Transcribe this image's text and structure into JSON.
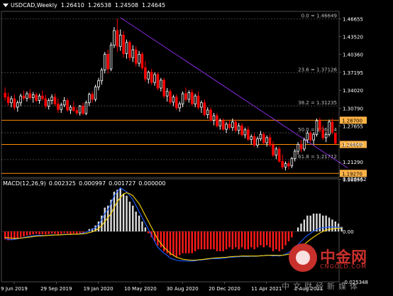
{
  "header": {
    "symbol": "USDCAD,Weekly",
    "open": "1.26410",
    "high": "1.26538",
    "low": "1.24508",
    "close": "1.24645"
  },
  "macd_header": {
    "label": "MACD(12,26,9)",
    "v1": "0.002325",
    "v2": "0.000997",
    "v3": "0.001727",
    "v4": "0.000000"
  },
  "watermark": {
    "brand": "中金网",
    "site": "CNGOLD.COM",
    "tagline": "中文财经新媒体"
  },
  "colors": {
    "background": "#000000",
    "bull_candle": "#ffffff",
    "bear_candle": "#ff0000",
    "trendline": "#8a2be2",
    "horizontal_level": "#ff8c00",
    "fib_level": "#505050",
    "macd_signal": "#ffd700",
    "macd_line": "#1e5cff",
    "price_tag": "#ffb347"
  },
  "chart_data": [
    {
      "type": "candlestick",
      "title": "USDCAD,Weekly",
      "ylim": [
        1.1855,
        1.48
      ],
      "y_ticks": [
        "1.46655",
        "1.43520",
        "1.40360",
        "1.37195",
        "1.34020",
        "1.30790",
        "1.27655",
        "1.24440",
        "1.21290",
        "1.18255"
      ],
      "x_ticks": [
        "9 Jun 2019",
        "29 Sep 2019",
        "19 Jan 2020",
        "10 May 2020",
        "30 Aug 2020",
        "20 Dec 2020",
        "11 Apr 2021",
        "1 Aug 2021"
      ],
      "fib_levels": [
        {
          "label": "0.0 = 1.46649",
          "value": 1.46649
        },
        {
          "label": "23.6 = 1.37126",
          "value": 1.37126
        },
        {
          "label": "38.2 = 1.31235",
          "value": 1.31235
        },
        {
          "label": "50.0 = 1.26474",
          "value": 1.26474
        },
        {
          "label": "61.8 = 1.21712",
          "value": 1.21712
        }
      ],
      "horizontal_levels": [
        {
          "label": "1.28700",
          "value": 1.287
        },
        {
          "label": "1.24400",
          "value": 1.244
        },
        {
          "label": "1.19270",
          "value": 1.1927
        }
      ],
      "trendline": {
        "from": {
          "week": 37,
          "price": 1.469
        },
        "to": {
          "week": 110,
          "price": 1.202
        }
      },
      "candles": [
        [
          1.335,
          1.345,
          1.322,
          1.328
        ],
        [
          1.328,
          1.336,
          1.312,
          1.318
        ],
        [
          1.318,
          1.33,
          1.31,
          1.325
        ],
        [
          1.325,
          1.333,
          1.305,
          1.31
        ],
        [
          1.31,
          1.322,
          1.302,
          1.318
        ],
        [
          1.318,
          1.334,
          1.312,
          1.33
        ],
        [
          1.33,
          1.34,
          1.322,
          1.326
        ],
        [
          1.326,
          1.338,
          1.32,
          1.334
        ],
        [
          1.334,
          1.342,
          1.323,
          1.327
        ],
        [
          1.327,
          1.337,
          1.318,
          1.332
        ],
        [
          1.332,
          1.336,
          1.319,
          1.322
        ],
        [
          1.322,
          1.334,
          1.316,
          1.33
        ],
        [
          1.33,
          1.34,
          1.322,
          1.325
        ],
        [
          1.325,
          1.332,
          1.308,
          1.312
        ],
        [
          1.312,
          1.326,
          1.306,
          1.322
        ],
        [
          1.322,
          1.333,
          1.315,
          1.328
        ],
        [
          1.328,
          1.334,
          1.312,
          1.316
        ],
        [
          1.316,
          1.325,
          1.3,
          1.306
        ],
        [
          1.306,
          1.318,
          1.3,
          1.314
        ],
        [
          1.314,
          1.328,
          1.31,
          1.322
        ],
        [
          1.322,
          1.326,
          1.302,
          1.305
        ],
        [
          1.305,
          1.314,
          1.298,
          1.31
        ],
        [
          1.31,
          1.32,
          1.302,
          1.304
        ],
        [
          1.304,
          1.31,
          1.296,
          1.3
        ],
        [
          1.3,
          1.314,
          1.295,
          1.312
        ],
        [
          1.312,
          1.318,
          1.296,
          1.299
        ],
        [
          1.299,
          1.322,
          1.296,
          1.318
        ],
        [
          1.318,
          1.336,
          1.312,
          1.333
        ],
        [
          1.333,
          1.338,
          1.318,
          1.324
        ],
        [
          1.324,
          1.35,
          1.32,
          1.346
        ],
        [
          1.346,
          1.362,
          1.34,
          1.357
        ],
        [
          1.357,
          1.38,
          1.35,
          1.376
        ],
        [
          1.376,
          1.408,
          1.37,
          1.404
        ],
        [
          1.404,
          1.412,
          1.37,
          1.378
        ],
        [
          1.378,
          1.425,
          1.374,
          1.42
        ],
        [
          1.42,
          1.452,
          1.415,
          1.446
        ],
        [
          1.446,
          1.467,
          1.408,
          1.418
        ],
        [
          1.418,
          1.448,
          1.41,
          1.438
        ],
        [
          1.438,
          1.445,
          1.398,
          1.405
        ],
        [
          1.405,
          1.43,
          1.396,
          1.425
        ],
        [
          1.425,
          1.428,
          1.392,
          1.398
        ],
        [
          1.398,
          1.42,
          1.39,
          1.412
        ],
        [
          1.412,
          1.418,
          1.382,
          1.388
        ],
        [
          1.388,
          1.41,
          1.382,
          1.404
        ],
        [
          1.404,
          1.408,
          1.376,
          1.38
        ],
        [
          1.38,
          1.392,
          1.355,
          1.36
        ],
        [
          1.36,
          1.375,
          1.352,
          1.372
        ],
        [
          1.372,
          1.378,
          1.35,
          1.354
        ],
        [
          1.354,
          1.372,
          1.348,
          1.368
        ],
        [
          1.368,
          1.372,
          1.34,
          1.344
        ],
        [
          1.344,
          1.362,
          1.338,
          1.358
        ],
        [
          1.358,
          1.362,
          1.326,
          1.33
        ],
        [
          1.33,
          1.344,
          1.32,
          1.338
        ],
        [
          1.338,
          1.342,
          1.315,
          1.319
        ],
        [
          1.319,
          1.332,
          1.312,
          1.328
        ],
        [
          1.328,
          1.333,
          1.305,
          1.309
        ],
        [
          1.309,
          1.32,
          1.302,
          1.316
        ],
        [
          1.316,
          1.338,
          1.31,
          1.334
        ],
        [
          1.334,
          1.345,
          1.32,
          1.324
        ],
        [
          1.324,
          1.34,
          1.318,
          1.336
        ],
        [
          1.336,
          1.342,
          1.312,
          1.316
        ],
        [
          1.316,
          1.334,
          1.31,
          1.33
        ],
        [
          1.33,
          1.338,
          1.306,
          1.31
        ],
        [
          1.31,
          1.322,
          1.3,
          1.318
        ],
        [
          1.318,
          1.324,
          1.294,
          1.297
        ],
        [
          1.297,
          1.31,
          1.29,
          1.305
        ],
        [
          1.305,
          1.31,
          1.284,
          1.287
        ],
        [
          1.287,
          1.3,
          1.278,
          1.295
        ],
        [
          1.295,
          1.3,
          1.274,
          1.277
        ],
        [
          1.277,
          1.29,
          1.27,
          1.286
        ],
        [
          1.286,
          1.29,
          1.268,
          1.271
        ],
        [
          1.271,
          1.284,
          1.264,
          1.28
        ],
        [
          1.28,
          1.288,
          1.27,
          1.274
        ],
        [
          1.274,
          1.29,
          1.268,
          1.284
        ],
        [
          1.284,
          1.288,
          1.266,
          1.269
        ],
        [
          1.269,
          1.282,
          1.262,
          1.277
        ],
        [
          1.277,
          1.282,
          1.258,
          1.261
        ],
        [
          1.261,
          1.274,
          1.255,
          1.27
        ],
        [
          1.27,
          1.276,
          1.25,
          1.253
        ],
        [
          1.253,
          1.262,
          1.244,
          1.258
        ],
        [
          1.258,
          1.264,
          1.24,
          1.243
        ],
        [
          1.243,
          1.258,
          1.238,
          1.254
        ],
        [
          1.254,
          1.268,
          1.25,
          1.262
        ],
        [
          1.262,
          1.266,
          1.244,
          1.247
        ],
        [
          1.247,
          1.26,
          1.24,
          1.256
        ],
        [
          1.256,
          1.262,
          1.24,
          1.243
        ],
        [
          1.243,
          1.25,
          1.222,
          1.225
        ],
        [
          1.225,
          1.24,
          1.218,
          1.236
        ],
        [
          1.236,
          1.24,
          1.212,
          1.214
        ],
        [
          1.214,
          1.226,
          1.2,
          1.204
        ],
        [
          1.204,
          1.214,
          1.198,
          1.21
        ],
        [
          1.21,
          1.215,
          1.2,
          1.206
        ],
        [
          1.206,
          1.222,
          1.202,
          1.219
        ],
        [
          1.219,
          1.236,
          1.214,
          1.232
        ],
        [
          1.232,
          1.248,
          1.226,
          1.244
        ],
        [
          1.244,
          1.252,
          1.23,
          1.236
        ],
        [
          1.236,
          1.256,
          1.232,
          1.252
        ],
        [
          1.252,
          1.268,
          1.246,
          1.264
        ],
        [
          1.264,
          1.268,
          1.248,
          1.252
        ],
        [
          1.252,
          1.266,
          1.244,
          1.262
        ],
        [
          1.262,
          1.29,
          1.258,
          1.286
        ],
        [
          1.286,
          1.292,
          1.266,
          1.27
        ],
        [
          1.27,
          1.278,
          1.252,
          1.256
        ],
        [
          1.256,
          1.266,
          1.248,
          1.262
        ],
        [
          1.262,
          1.288,
          1.258,
          1.284
        ],
        [
          1.284,
          1.29,
          1.262,
          1.266
        ],
        [
          1.264,
          1.265,
          1.245,
          1.246
        ]
      ]
    },
    {
      "type": "bar",
      "title": "MACD(12,26,9)",
      "y_ticks": [
        "0.026462",
        "0.00",
        "-0.025348"
      ],
      "ylim": [
        -0.0254,
        0.0265
      ],
      "histogram": [
        -0.004,
        -0.0045,
        -0.004,
        -0.0042,
        -0.0035,
        -0.003,
        -0.0025,
        -0.002,
        -0.0018,
        -0.0015,
        -0.0012,
        -0.0015,
        -0.0014,
        -0.0016,
        -0.0013,
        -0.001,
        -0.0012,
        -0.0015,
        -0.0012,
        -0.0008,
        -0.001,
        -0.0012,
        -0.001,
        -0.0012,
        -0.0008,
        -0.0006,
        0.0,
        0.0012,
        0.0015,
        0.003,
        0.005,
        0.008,
        0.012,
        0.013,
        0.016,
        0.02,
        0.021,
        0.022,
        0.019,
        0.018,
        0.015,
        0.013,
        0.01,
        0.008,
        0.005,
        0.002,
        -0.001,
        -0.003,
        -0.005,
        -0.007,
        -0.008,
        -0.01,
        -0.011,
        -0.012,
        -0.012,
        -0.013,
        -0.012,
        -0.011,
        -0.011,
        -0.011,
        -0.011,
        -0.01,
        -0.009,
        -0.009,
        -0.009,
        -0.009,
        -0.009,
        -0.009,
        -0.01,
        -0.01,
        -0.01,
        -0.009,
        -0.008,
        -0.009,
        -0.008,
        -0.009,
        -0.008,
        -0.009,
        -0.009,
        -0.008,
        -0.009,
        -0.008,
        -0.007,
        -0.008,
        -0.007,
        -0.008,
        -0.01,
        -0.009,
        -0.01,
        -0.009,
        -0.007,
        -0.005,
        -0.003,
        0.0,
        0.002,
        0.004,
        0.006,
        0.008,
        0.008,
        0.009,
        0.009,
        0.009,
        0.008,
        0.008,
        0.007,
        0.006,
        0.005,
        0.004,
        0.0023
      ],
      "signal": [
        -0.003,
        -0.0032,
        -0.0034,
        -0.0035,
        -0.0035,
        -0.0034,
        -0.0032,
        -0.003,
        -0.0028,
        -0.0026,
        -0.0024,
        -0.0023,
        -0.0022,
        -0.0021,
        -0.002,
        -0.0019,
        -0.0018,
        -0.0018,
        -0.0017,
        -0.0016,
        -0.0015,
        -0.0015,
        -0.0014,
        -0.0014,
        -0.0013,
        -0.0012,
        -0.001,
        -0.0006,
        -0.0002,
        0.0005,
        0.0015,
        0.003,
        0.005,
        0.007,
        0.009,
        0.012,
        0.015,
        0.017,
        0.019,
        0.0195,
        0.019,
        0.018,
        0.016,
        0.014,
        0.011,
        0.008,
        0.005,
        0.002,
        -0.001,
        -0.004,
        -0.006,
        -0.008,
        -0.0095,
        -0.011,
        -0.012,
        -0.013,
        -0.0135,
        -0.014,
        -0.0142,
        -0.0144,
        -0.0145,
        -0.0145,
        -0.0143,
        -0.0142,
        -0.014,
        -0.0138,
        -0.0136,
        -0.0134,
        -0.0133,
        -0.0132,
        -0.0131,
        -0.013,
        -0.0128,
        -0.0127,
        -0.0126,
        -0.0125,
        -0.0124,
        -0.0124,
        -0.0124,
        -0.0124,
        -0.0124,
        -0.0124,
        -0.0123,
        -0.0122,
        -0.0121,
        -0.012,
        -0.012,
        -0.012,
        -0.0121,
        -0.012,
        -0.0118,
        -0.0115,
        -0.011,
        -0.0102,
        -0.0092,
        -0.008,
        -0.0066,
        -0.0052,
        -0.004,
        -0.0028,
        -0.0018,
        -0.0008,
        0.0,
        0.0006,
        0.001,
        0.0013,
        0.0015,
        0.0016,
        0.0017
      ],
      "macd_line": [
        -0.0035,
        -0.004,
        -0.0042,
        -0.004,
        -0.0037,
        -0.0033,
        -0.003,
        -0.0027,
        -0.0024,
        -0.0022,
        -0.002,
        -0.002,
        -0.002,
        -0.0021,
        -0.0019,
        -0.0017,
        -0.0017,
        -0.0018,
        -0.0016,
        -0.0014,
        -0.0015,
        -0.0016,
        -0.0014,
        -0.0015,
        -0.0011,
        -0.0008,
        -0.0004,
        0.0004,
        0.001,
        0.002,
        0.0035,
        0.006,
        0.009,
        0.011,
        0.014,
        0.018,
        0.02,
        0.022,
        0.021,
        0.02,
        0.018,
        0.016,
        0.013,
        0.01,
        0.007,
        0.004,
        0.001,
        -0.002,
        -0.005,
        -0.008,
        -0.0095,
        -0.011,
        -0.012,
        -0.0135,
        -0.014,
        -0.0145,
        -0.0148,
        -0.0148,
        -0.0149,
        -0.015,
        -0.015,
        -0.0148,
        -0.0145,
        -0.0144,
        -0.0142,
        -0.014,
        -0.0138,
        -0.0137,
        -0.0138,
        -0.0137,
        -0.0136,
        -0.0133,
        -0.013,
        -0.013,
        -0.0128,
        -0.0128,
        -0.0126,
        -0.0127,
        -0.0127,
        -0.0125,
        -0.0126,
        -0.0125,
        -0.0122,
        -0.0122,
        -0.0119,
        -0.0121,
        -0.0124,
        -0.0122,
        -0.0124,
        -0.012,
        -0.0114,
        -0.0106,
        -0.0096,
        -0.0082,
        -0.0066,
        -0.005,
        -0.0034,
        -0.002,
        -0.001,
        0.0002,
        0.001,
        0.0016,
        0.0019,
        0.0021,
        0.0022,
        0.0022,
        0.0022,
        0.0021,
        0.002
      ]
    }
  ]
}
